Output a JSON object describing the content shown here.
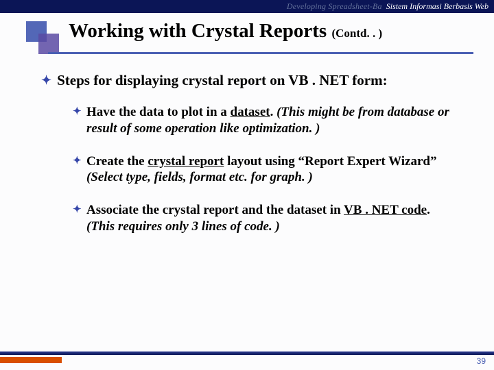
{
  "header": {
    "faded_text": "Developing Spreadsheet-Ba",
    "course_label": "Sistem Informasi Berbasis Web"
  },
  "title": {
    "main": "Working with Crystal Reports ",
    "suffix": "(Contd. . )"
  },
  "lead": {
    "text": "Steps for displaying crystal report on VB . NET form:"
  },
  "bullets": [
    {
      "pre": "Have the data to plot in a ",
      "u1": "dataset",
      "mid": ". ",
      "ital": "(This might be from database or result of some operation like optimization. )"
    },
    {
      "pre": "Create the ",
      "u1": "crystal report",
      "mid": " layout using “Report Expert Wizard” ",
      "ital": "(Select type, fields, format etc. for graph. )"
    },
    {
      "pre": "Associate the crystal report and the dataset in ",
      "u1": "VB . NET code",
      "mid": ". ",
      "ital": "(This requires only 3 lines of code. )"
    }
  ],
  "page_number": "39"
}
